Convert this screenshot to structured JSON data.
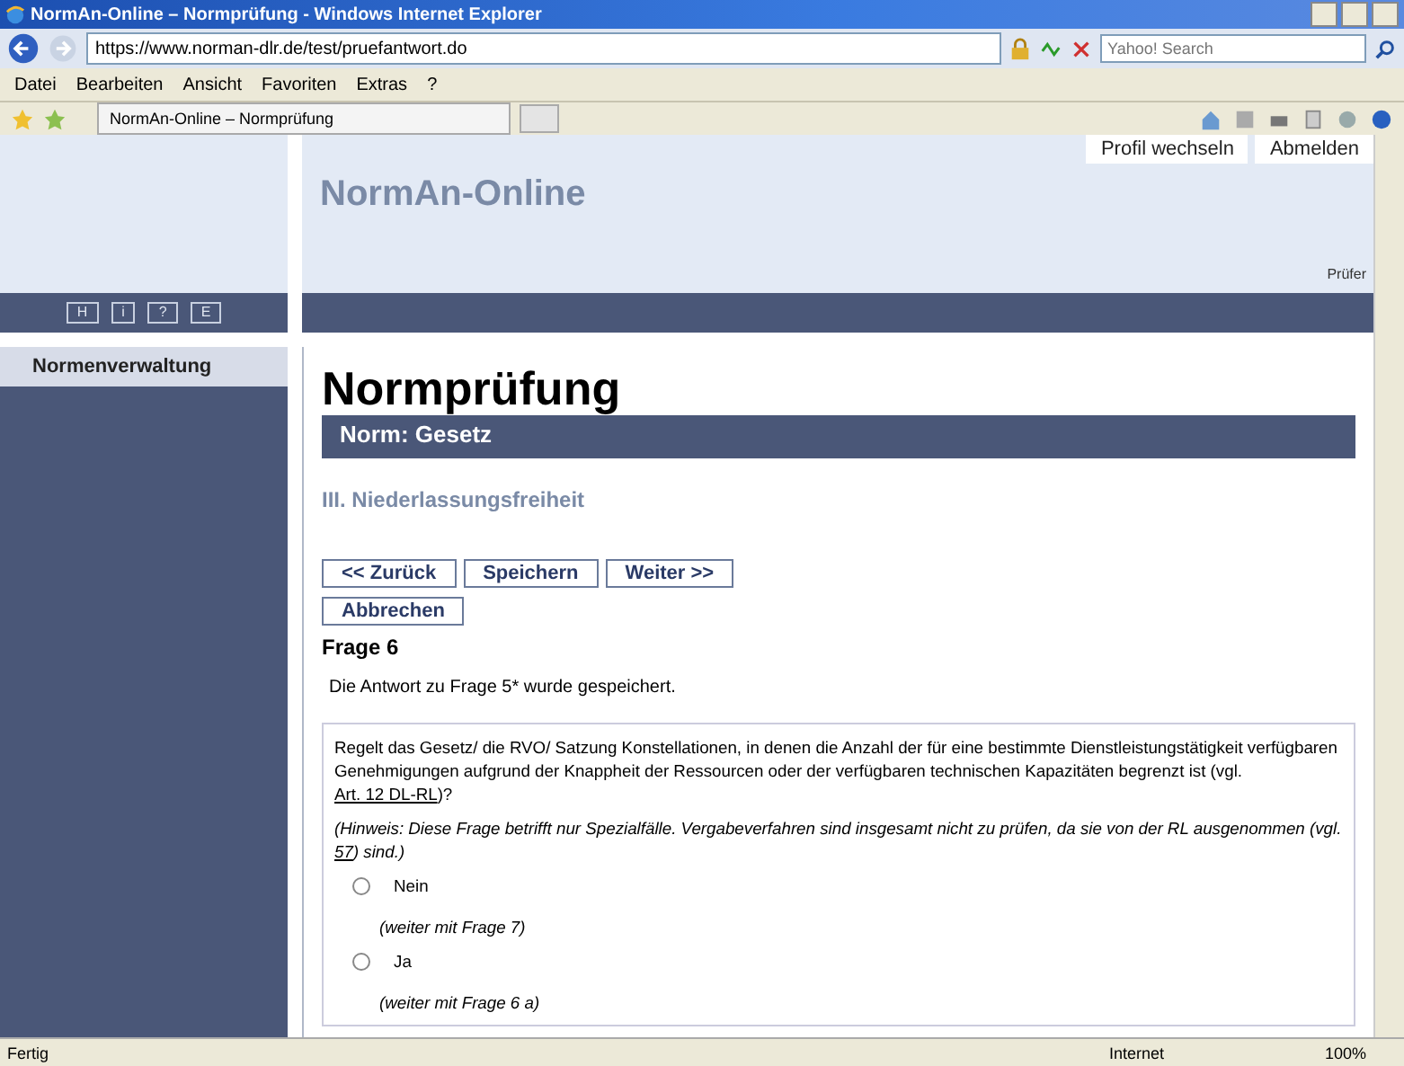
{
  "browser": {
    "title": "NormAn-Online – Normprüfung - Windows Internet Explorer",
    "address": "https://www.norman-dlr.de/test/pruefantwort.do",
    "search_placeholder": "Yahoo! Search",
    "menu": [
      "Datei",
      "Bearbeiten",
      "Ansicht",
      "Favoriten",
      "Extras",
      "?"
    ],
    "tab_title": "NormAn-Online – Normprüfung",
    "status": "Fertig",
    "zone": "Internet",
    "zoom": "100%"
  },
  "header": {
    "links": [
      "Profil wechseln",
      "Abmelden"
    ],
    "app_title": "NormAn-Online",
    "role": "Prüfer"
  },
  "sidebar": {
    "keys": [
      "H",
      "i",
      "?",
      "E"
    ],
    "items": [
      {
        "label": "Normenverwaltung",
        "selected": true
      }
    ]
  },
  "content": {
    "heading": "Normprüfung",
    "norm_bar": "Norm: Gesetz",
    "section": "III. Niederlassungsfreiheit",
    "buttons": [
      "<< Zurück",
      "Speichern",
      "Weiter >>"
    ],
    "cancel": "Abbrechen",
    "question_title": "Frage 6",
    "saved_message": "Die Antwort zu Frage 5* wurde gespeichert.",
    "question": {
      "before": "Regelt das Gesetz/ die RVO/ Satzung Konstellationen, in denen die Anzahl der für eine bestimmte Dienstleistungstätigkeit verfügbaren Genehmigungen aufgrund der Knappheit der Ressourcen oder der verfügbaren technischen Kapazitäten begrenzt ist (vgl. ",
      "link": "Art. 12 DL-RL",
      "after": ")?"
    },
    "hint": {
      "before": "(Hinweis: Diese Frage betrifft nur Spezialfälle. Vergabeverfahren sind insgesamt nicht zu prüfen, da sie von der RL ausgenommen (vgl. ",
      "link": "57",
      "after": ") sind.)"
    },
    "options": [
      {
        "label": "Nein",
        "note": "(weiter mit Frage 7)",
        "selected": false
      },
      {
        "label": "Ja",
        "note": "(weiter mit Frage 6 a)",
        "selected": false
      }
    ]
  }
}
